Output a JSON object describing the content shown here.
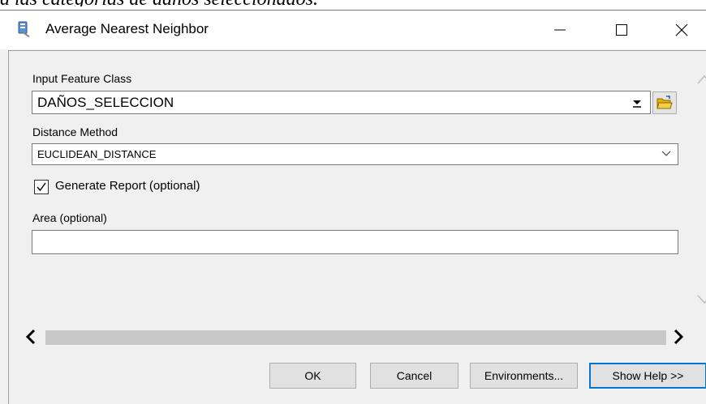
{
  "caption": "a las categorías de daños seleccionados.",
  "window": {
    "title": "Average Nearest Neighbor",
    "app_icon": "arcgis-tool-icon"
  },
  "form": {
    "input_feature_class": {
      "label": "Input Feature Class",
      "value": "DAÑOS_SELECCION"
    },
    "distance_method": {
      "label": "Distance Method",
      "value": "EUCLIDEAN_DISTANCE"
    },
    "generate_report": {
      "label": "Generate Report (optional)",
      "checked": true
    },
    "area": {
      "label": "Area (optional)",
      "value": ""
    }
  },
  "buttons": {
    "ok": "OK",
    "cancel": "Cancel",
    "environments": "Environments...",
    "show_help": "Show Help >>"
  },
  "colors": {
    "accent": "#0078d7",
    "folder": "#e8b100"
  }
}
